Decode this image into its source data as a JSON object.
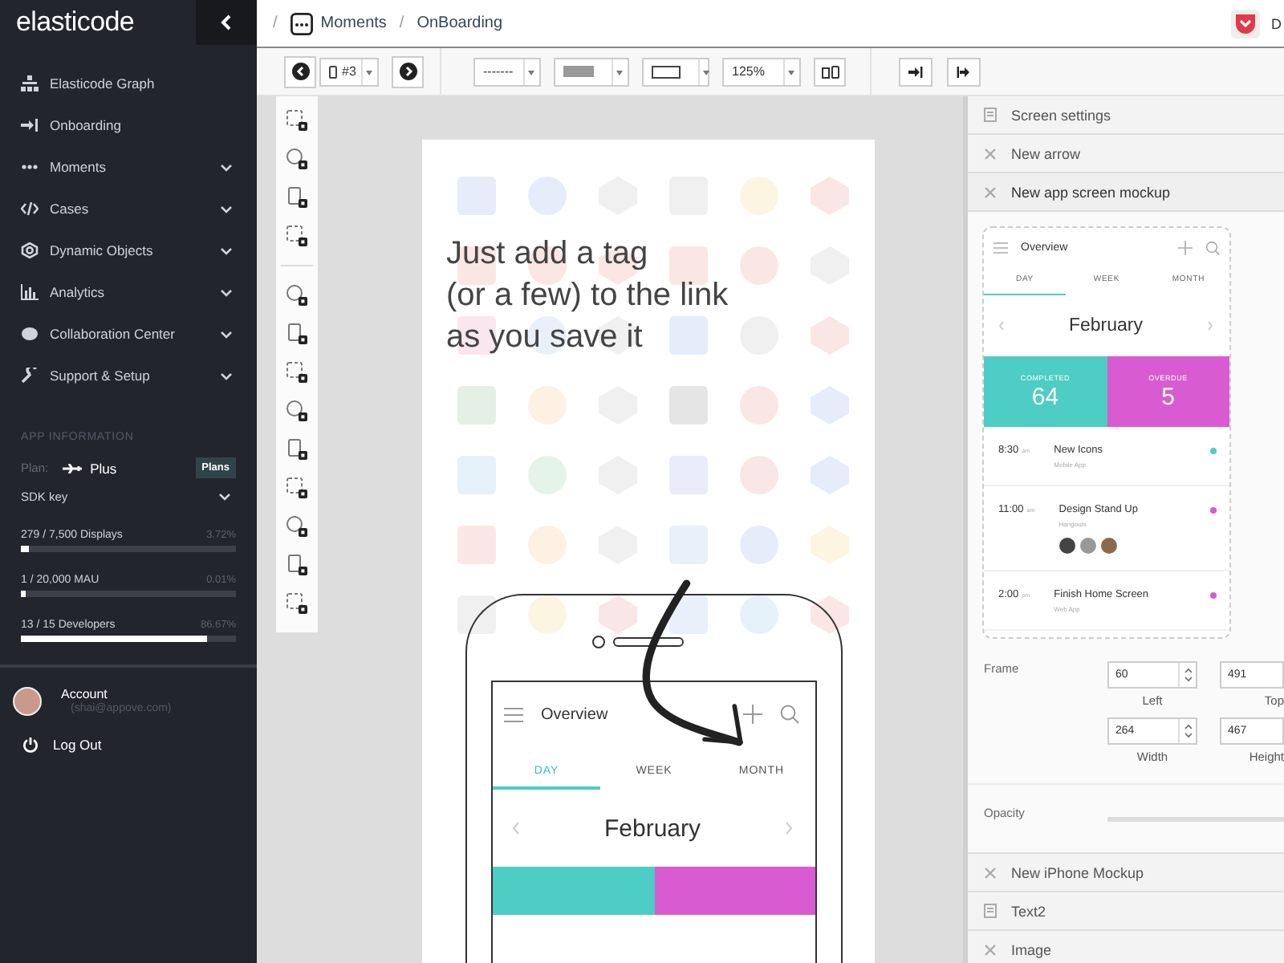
{
  "sidebar": {
    "logo": "elasticode",
    "nav": [
      {
        "label": "Elasticode Graph",
        "expandable": false
      },
      {
        "label": "Onboarding",
        "expandable": false
      },
      {
        "label": "Moments",
        "expandable": true
      },
      {
        "label": "Cases",
        "expandable": true
      },
      {
        "label": "Dynamic Objects",
        "expandable": true
      },
      {
        "label": "Analytics",
        "expandable": true
      },
      {
        "label": "Collaboration Center",
        "expandable": true
      },
      {
        "label": "Support & Setup",
        "expandable": true
      }
    ],
    "app_info": {
      "heading": "APP INFORMATION",
      "plan_label": "Plan:",
      "plan": "Plus",
      "plans_button": "Plans",
      "sdk_key": "SDK key",
      "usage": [
        {
          "label": "279 / 7,500 Displays",
          "percent": "3.72%",
          "level": 0.0372
        },
        {
          "label": "1 / 20,000 MAU",
          "percent": "0.01%",
          "level": 0.0001
        },
        {
          "label": "13 / 15 Developers",
          "percent": "86.67%",
          "level": 0.8667
        }
      ]
    },
    "account": {
      "name": "Account",
      "email": "(shai@appove.com)"
    },
    "logout": "Log Out"
  },
  "header": {
    "breadcrumb": [
      {
        "separator": "/",
        "label": "Moments"
      },
      {
        "separator": "/",
        "label": "OnBoarding"
      }
    ],
    "user": "D"
  },
  "toolbar": {
    "screen": "#3",
    "line_style": "-------",
    "zoom": "125%"
  },
  "canvas": {
    "headline": [
      "Just add a tag",
      "(or a few) to the link",
      "as you save it"
    ],
    "phone": {
      "title": "Overview",
      "tabs": [
        {
          "label": "DAY",
          "selected": true
        },
        {
          "label": "WEEK",
          "selected": false
        },
        {
          "label": "MONTH",
          "selected": false
        }
      ],
      "month": "February",
      "stats": [
        {
          "color": "#4ecdc4"
        },
        {
          "color": "#d95bd1"
        }
      ]
    }
  },
  "panel": {
    "sections_top": [
      {
        "label": "Screen settings",
        "kind": "settings",
        "expanded": false
      },
      {
        "label": "New arrow",
        "kind": "object",
        "expanded": false
      },
      {
        "label": "New app screen mockup",
        "kind": "object",
        "expanded": true
      }
    ],
    "mockup": {
      "title": "Overview",
      "tabs": [
        {
          "label": "DAY",
          "selected": true
        },
        {
          "label": "WEEK",
          "selected": false
        },
        {
          "label": "MONTH",
          "selected": false
        }
      ],
      "month": "February",
      "stats": [
        {
          "label": "COMPLETED",
          "value": "64",
          "color": "#4ecdc4"
        },
        {
          "label": "OVERDUE",
          "value": "5",
          "color": "#d95bd1"
        }
      ],
      "events": [
        {
          "time": "8:30",
          "ampm": "am",
          "title": "New Icons",
          "sub": "Mobile App",
          "color": "#4ecdc4",
          "kind": "task"
        },
        {
          "time": "11:00",
          "ampm": "am",
          "title": "Design Stand Up",
          "sub": "Hangouts",
          "color": "#d95bd1",
          "kind": "meeting"
        },
        {
          "time": "2:00",
          "ampm": "pm",
          "title": "Finish Home Screen",
          "sub": "Web App",
          "color": "#d95bd1",
          "kind": "task"
        }
      ]
    },
    "frame": {
      "label": "Frame",
      "fields": [
        {
          "label": "Left",
          "value": "60"
        },
        {
          "label": "Top",
          "value": "491"
        },
        {
          "label": "Width",
          "value": "264"
        },
        {
          "label": "Height",
          "value": "467"
        }
      ]
    },
    "opacity": {
      "label": "Opacity"
    },
    "sections_bottom": [
      {
        "label": "New iPhone Mockup",
        "kind": "object",
        "expanded": false
      },
      {
        "label": "Text2",
        "kind": "text",
        "expanded": false
      },
      {
        "label": "Image",
        "kind": "object",
        "expanded": false
      }
    ]
  }
}
